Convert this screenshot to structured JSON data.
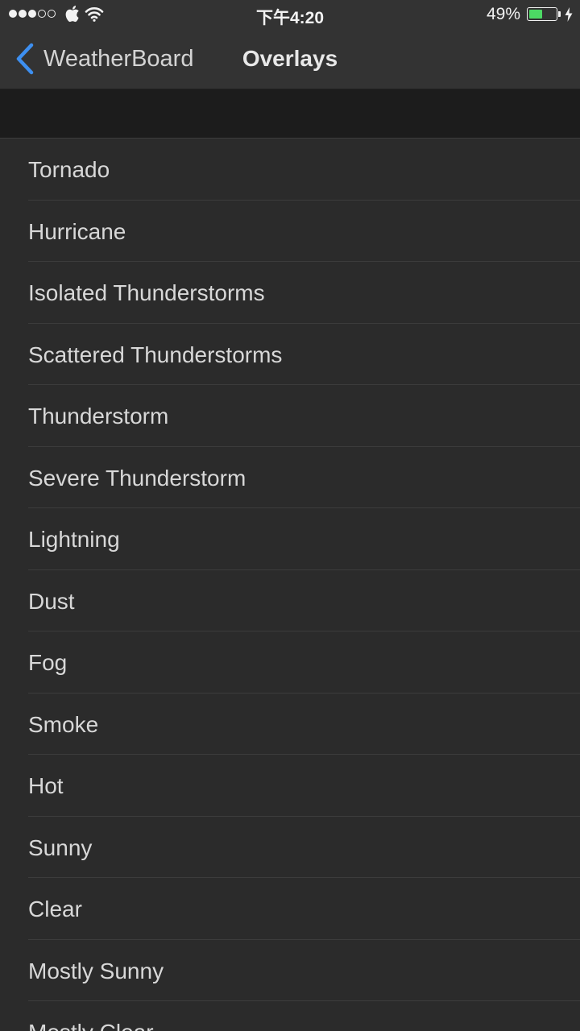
{
  "status_bar": {
    "time": "下午4:20",
    "battery_percent_label": "49%",
    "battery_level": 0.49,
    "battery_color": "#4cd964",
    "signal_bars_filled": 3,
    "signal_bars_total": 5,
    "icons": [
      "apple-icon",
      "wifi-icon",
      "charging-bolt-icon"
    ]
  },
  "nav": {
    "back_label": "WeatherBoard",
    "back_icon": "chevron-left-icon",
    "back_color": "#3d8ff0",
    "title": "Overlays"
  },
  "overlays": [
    {
      "label": "Tornado"
    },
    {
      "label": "Hurricane"
    },
    {
      "label": "Isolated Thunderstorms"
    },
    {
      "label": "Scattered Thunderstorms"
    },
    {
      "label": "Thunderstorm"
    },
    {
      "label": "Severe Thunderstorm"
    },
    {
      "label": "Lightning"
    },
    {
      "label": "Dust"
    },
    {
      "label": "Fog"
    },
    {
      "label": "Smoke"
    },
    {
      "label": "Hot"
    },
    {
      "label": "Sunny"
    },
    {
      "label": "Clear"
    },
    {
      "label": "Mostly Sunny"
    },
    {
      "label": "Mostly Clear"
    }
  ]
}
